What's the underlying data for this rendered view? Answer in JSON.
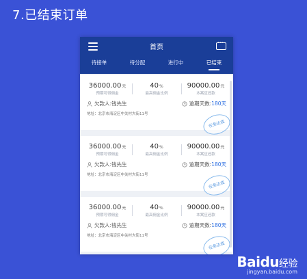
{
  "slide": {
    "title": "7.已结束订单"
  },
  "app": {
    "header_title": "首页",
    "tabs": [
      {
        "label": "待接单",
        "active": false
      },
      {
        "label": "待分配",
        "active": false
      },
      {
        "label": "进行中",
        "active": false
      },
      {
        "label": "已结束",
        "active": true
      }
    ]
  },
  "orders": [
    {
      "reward_value": "36000.00",
      "reward_unit": "元",
      "reward_label": "预期可得佣金",
      "ratio_value": "40",
      "ratio_unit": "%",
      "ratio_label": "最高佣金比例",
      "amount_value": "90000.00",
      "amount_unit": "元",
      "amount_label": "本案应还款",
      "debtor": "欠款人:钱先生",
      "overdue_label": "逾期天数:",
      "overdue_days": "180天",
      "address": "地址：北京市海淀区中关村大街11号",
      "stamp": "任务达成"
    },
    {
      "reward_value": "36000.00",
      "reward_unit": "元",
      "reward_label": "预期可得佣金",
      "ratio_value": "40",
      "ratio_unit": "%",
      "ratio_label": "最高佣金比例",
      "amount_value": "90000.00",
      "amount_unit": "元",
      "amount_label": "本案应还款",
      "debtor": "欠款人:钱先生",
      "overdue_label": "逾期天数:",
      "overdue_days": "180天",
      "address": "地址：北京市海淀区中关村大街11号",
      "stamp": "任务达成"
    },
    {
      "reward_value": "36000.00",
      "reward_unit": "元",
      "reward_label": "预期可得佣金",
      "ratio_value": "40",
      "ratio_unit": "%",
      "ratio_label": "最高佣金比例",
      "amount_value": "90000.00",
      "amount_unit": "元",
      "amount_label": "本案应还款",
      "debtor": "欠款人:钱先生",
      "overdue_label": "逾期天数:",
      "overdue_days": "180天",
      "address": "地址：北京市海淀区中关村大街11号",
      "stamp": "任务达成"
    }
  ],
  "watermark": {
    "logo": "Baidu",
    "logo_cn": "经验",
    "url": "jingyan.baidu.com"
  },
  "colors": {
    "background": "#3a52d6",
    "header": "#1a3e98",
    "accent": "#2a6de0"
  }
}
